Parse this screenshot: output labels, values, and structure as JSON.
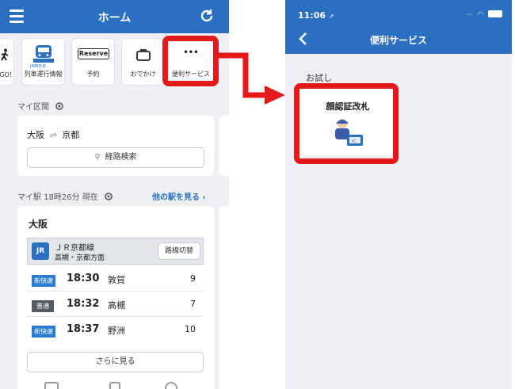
{
  "left_screen": {
    "header": {
      "title": "ホーム"
    },
    "tiles": [
      {
        "label": "GO!",
        "icon": "walking-person-icon"
      },
      {
        "label": "列車運行情報",
        "icon": "train-icon",
        "badge": "JR西日本"
      },
      {
        "label": "予約",
        "icon": "reserve-icon",
        "badge": "Reserve"
      },
      {
        "label": "おでかけ",
        "icon": "bag-icon"
      },
      {
        "label": "便利サービス",
        "icon": "more-dots-icon",
        "glyph": "•••"
      }
    ],
    "my_section": {
      "label": "マイ区間",
      "route": {
        "from": "大阪",
        "arrow": "⇌",
        "to": "京都"
      },
      "route_search_label": "経路検索"
    },
    "my_station": {
      "label": "マイ駅 18時26分 現在",
      "other_link": "他の駅を見る",
      "station": "大阪",
      "line": {
        "logo": "JR",
        "name": "ＪＲ京都線",
        "direction": "高槻・京都方面",
        "switch_label": "路線切替"
      },
      "trains": [
        {
          "type": "新快速",
          "color": "#2a7bd0",
          "time": "18:30",
          "dest": "敦賀",
          "platform": "9"
        },
        {
          "type": "普通",
          "color": "#555b63",
          "time": "18:32",
          "dest": "高槻",
          "platform": "7"
        },
        {
          "type": "新快速",
          "color": "#2a7bd0",
          "time": "18:37",
          "dest": "野洲",
          "platform": "10"
        }
      ],
      "more_label": "さらに見る"
    }
  },
  "right_screen": {
    "status": {
      "time": "11:06"
    },
    "header": {
      "title": "便利サービス"
    },
    "section_label": "お試し",
    "service_card": {
      "title": "顔認証改札",
      "icon": "face-id-gate-icon",
      "ic_text": "IC"
    }
  },
  "colors": {
    "accent": "#2a6fc0",
    "highlight": "#e41a1a"
  }
}
